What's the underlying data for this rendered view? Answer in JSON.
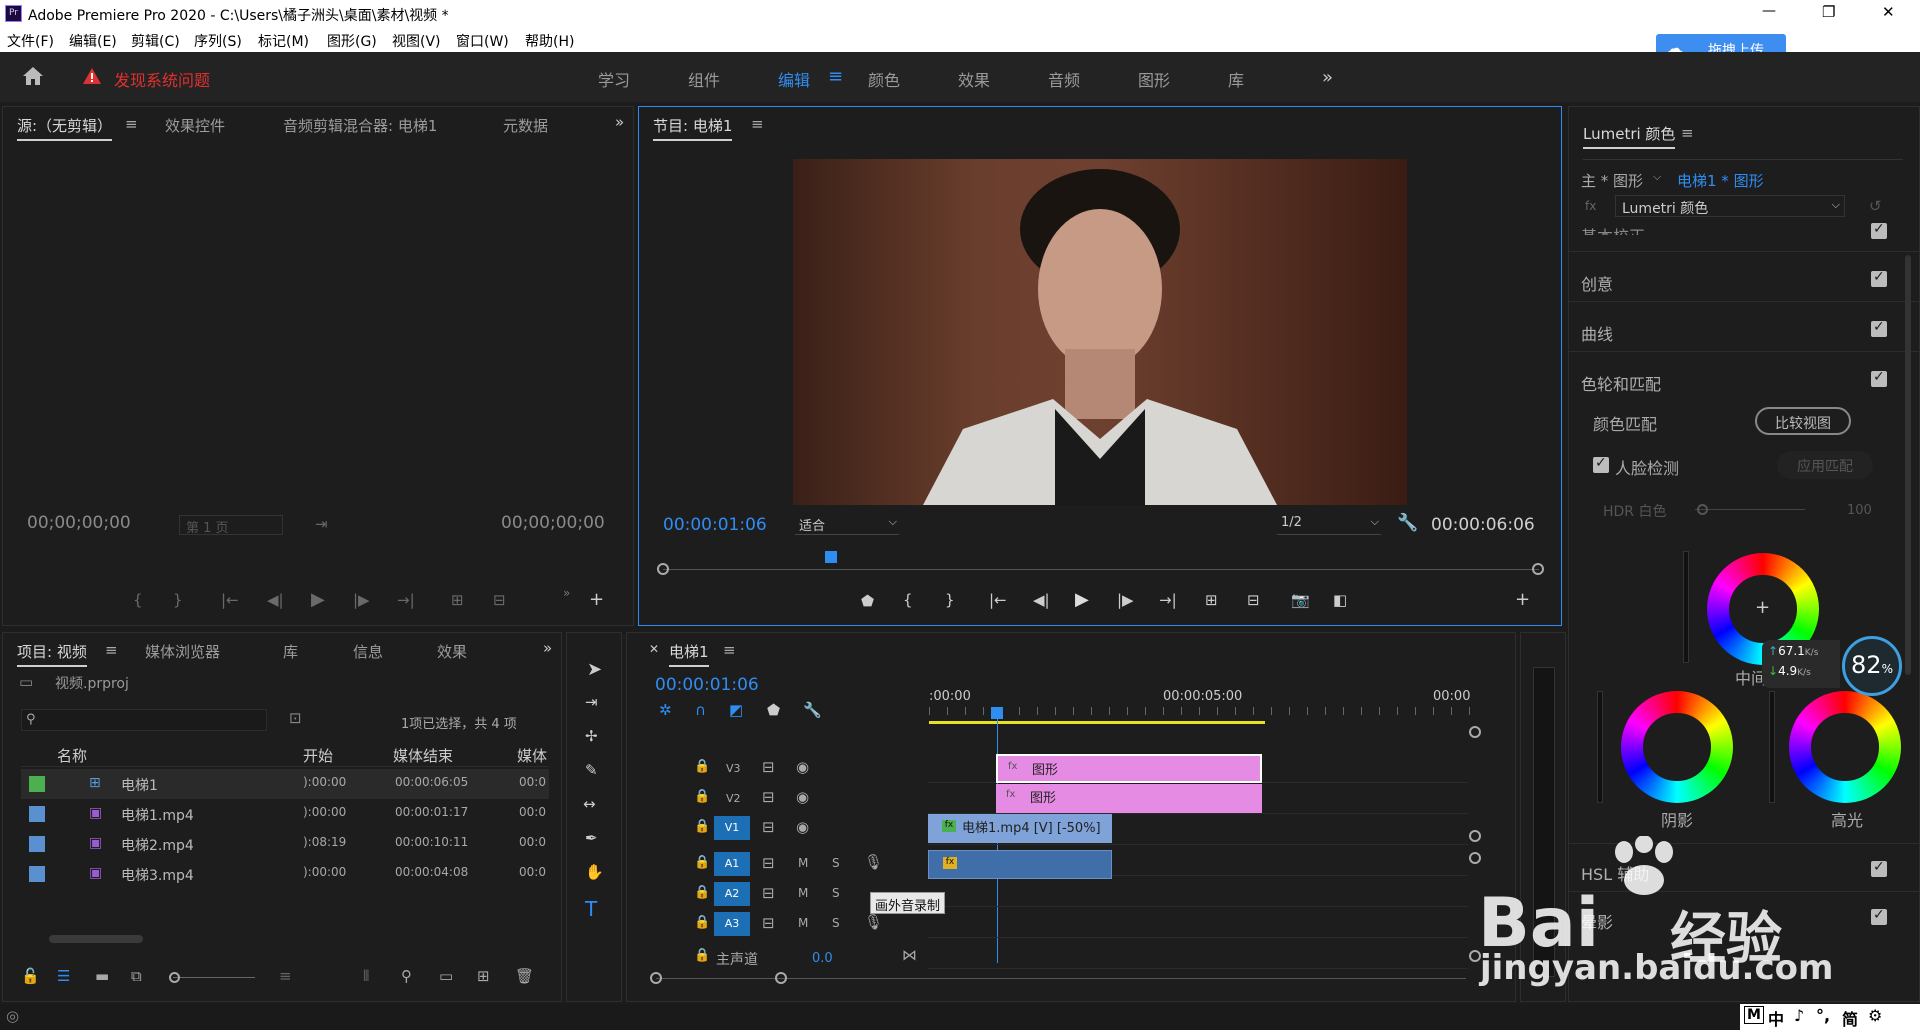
{
  "window": {
    "title": "Adobe Premiere Pro 2020 - C:\\Users\\橘子洲头\\桌面\\素材\\视频 *",
    "minimize": "—",
    "maximize": "❐",
    "close": "✕"
  },
  "menu": [
    "文件(F)",
    "编辑(E)",
    "剪辑(C)",
    "序列(S)",
    "标记(M)",
    "图形(G)",
    "视图(V)",
    "窗口(W)",
    "帮助(H)"
  ],
  "upload_button": "拖拽上传",
  "workspace": {
    "alert": "发现系统问题",
    "tabs": [
      "学习",
      "组件",
      "编辑",
      "颜色",
      "效果",
      "音频",
      "图形",
      "库"
    ],
    "active": "编辑",
    "more": "»"
  },
  "source_panel": {
    "tabs": [
      "源:（无剪辑）",
      "效果控件",
      "音频剪辑混合器: 电梯1",
      "元数据"
    ],
    "tc_left": "00;00;00;00",
    "page": "第 1 页",
    "tc_right": "00;00;00;00"
  },
  "program_panel": {
    "title": "节目: 电梯1",
    "tc_current": "00:00:01:06",
    "fit": "适合",
    "resolution": "1/2",
    "tc_duration": "00:00:06:06"
  },
  "project_panel": {
    "tabs": [
      "项目: 视频",
      "媒体浏览器",
      "库",
      "信息",
      "效果"
    ],
    "file": "视频.prproj",
    "search_placeholder": "",
    "selection": "1项已选择，共 4 项",
    "columns": [
      "名称",
      "开始",
      "媒体结束",
      "媒体"
    ],
    "rows": [
      {
        "name": "电梯1",
        "start": "):00:00",
        "end": "00:00:06:05",
        "media": "00:0",
        "color": "#4caf50"
      },
      {
        "name": "电梯1.mp4",
        "start": "):00:00",
        "end": "00:00:01:17",
        "media": "00:0",
        "color": "#5a8fd0"
      },
      {
        "name": "电梯2.mp4",
        "start": "):08:19",
        "end": "00:00:10:11",
        "media": "00:0",
        "color": "#5a8fd0"
      },
      {
        "name": "电梯3.mp4",
        "start": "):00:00",
        "end": "00:00:04:08",
        "media": "00:0",
        "color": "#5a8fd0"
      }
    ]
  },
  "timeline": {
    "title": "电梯1",
    "tc": "00:00:01:06",
    "ruler": [
      ":00:00",
      "00:00:05:00",
      "00:00"
    ],
    "tracks": {
      "v3": "V3",
      "v2": "V2",
      "v1": "V1",
      "a1": "A1",
      "a2": "A2",
      "a3": "A3",
      "master": "主声道",
      "master_val": "0.0"
    },
    "clips": {
      "g1": "图形",
      "g2": "图形",
      "video": "电梯1.mp4 [V] [-50%]"
    },
    "tooltip": "画外音录制"
  },
  "lumetri": {
    "title": "Lumetri 颜色",
    "source_left": "主 * 图形",
    "source_right": "电梯1 * 图形",
    "effect": "Lumetri 颜色",
    "sections": [
      "基本校正",
      "创意",
      "曲线",
      "色轮和匹配"
    ],
    "color_match": "颜色匹配",
    "compare": "比较视图",
    "face": "人脸检测",
    "apply": "应用匹配",
    "hdr": "HDR 白色",
    "hdr_val": "100",
    "midtone": "中间调",
    "shadow": "阴影",
    "highlight": "高光",
    "hsl": "HSL 辅助",
    "vignette": "晕影"
  },
  "net": {
    "up": "67.1",
    "down": "4.9",
    "unit": "K/s",
    "percent": "82",
    "pct_sign": "%"
  },
  "watermark": {
    "brand": "Bai",
    "sub": "经验",
    "url": "jingyan.baidu.com"
  },
  "ime": [
    "M",
    "中",
    "♪",
    "°,",
    "简",
    "⚙"
  ]
}
